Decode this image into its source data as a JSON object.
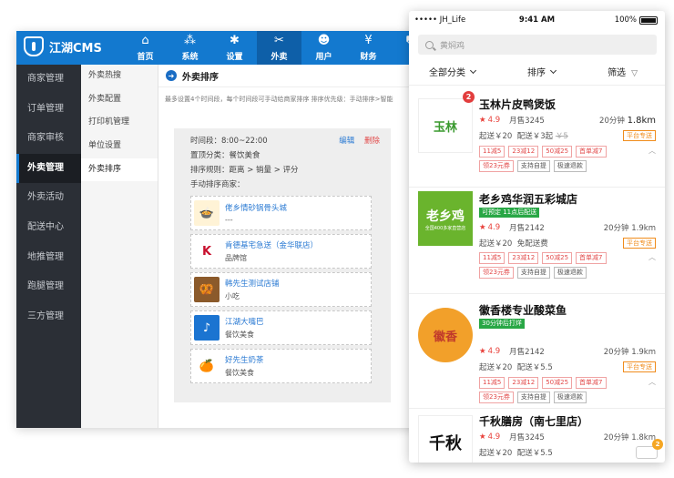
{
  "cms": {
    "logo_text": "江湖CMS",
    "nav": [
      {
        "icon": "⌂",
        "icon_name": "home-icon",
        "label": "首页"
      },
      {
        "icon": "⁂",
        "icon_name": "system-icon",
        "label": "系统"
      },
      {
        "icon": "✱",
        "icon_name": "gear-icon",
        "label": "设置"
      },
      {
        "icon": "✂",
        "icon_name": "takeout-icon",
        "label": "外卖"
      },
      {
        "icon": "☻",
        "icon_name": "user-icon",
        "label": "用户"
      },
      {
        "icon": "¥",
        "icon_name": "finance-icon",
        "label": "财务"
      },
      {
        "icon": "⛟",
        "icon_name": "operation-icon",
        "label": "运"
      }
    ],
    "sidebar": [
      {
        "label": "商家管理"
      },
      {
        "label": "订单管理"
      },
      {
        "label": "商家审核"
      },
      {
        "label": "外卖管理"
      },
      {
        "label": "外卖活动"
      },
      {
        "label": "配送中心"
      },
      {
        "label": "地推管理"
      },
      {
        "label": "跑腿管理"
      },
      {
        "label": "三方管理"
      }
    ],
    "subnav": [
      {
        "label": "外卖热搜"
      },
      {
        "label": "外卖配置"
      },
      {
        "label": "打印机管理"
      },
      {
        "label": "单位设置"
      },
      {
        "label": "外卖排序"
      }
    ],
    "content": {
      "title": "外卖排序",
      "hint": "最多设置4个时间段，每个时间段可手动给商家排序 排序优先级：手动排序>智能",
      "time_range": "时间段：8:00~22:00",
      "edit": "编辑",
      "delete": "删除",
      "top_category": "置顶分类：餐饮美食",
      "sort_rule": "排序规则：距离 > 销量 > 评分",
      "manual_label": "手动排序商家：",
      "shops": [
        {
          "name": "佬乡情砂锅骨头城",
          "category": "---",
          "thumb": "🍲"
        },
        {
          "name": "肯德基宅急送（金华联店）",
          "category": "品牌馆",
          "thumb": "K"
        },
        {
          "name": "韩先生测试店铺",
          "category": "小吃",
          "thumb": "🥨"
        },
        {
          "name": "江湖大嘴巴",
          "category": "餐饮美食",
          "thumb": "♪"
        },
        {
          "name": "好先生奶茶",
          "category": "餐饮美食",
          "thumb": "🍊"
        }
      ]
    }
  },
  "phone": {
    "status_left": "••••• JH_Life",
    "time": "9:41 AM",
    "battery": "100%",
    "search_placeholder": "黄焖鸡",
    "filters": [
      "全部分类",
      "排序",
      "筛选"
    ],
    "stores": [
      {
        "name": "玉林片皮鸭煲饭",
        "badge": "2",
        "logo": "玉林",
        "rating": "4.9",
        "sales": "月售3245",
        "time": "20分钟",
        "distance": "1.8km",
        "min_order": "起送￥20",
        "delivery": "配送￥3起",
        "old_delivery": "￥5",
        "platform": "平台专送",
        "promos": [
          "11减5",
          "23减12",
          "50减25",
          "首单减7"
        ],
        "extras": [
          "领23元券",
          "支持自提",
          "极速退款"
        ]
      },
      {
        "name": "老乡鸡华润五彩城店",
        "logo": "老乡鸡",
        "logo_sub": "全国400多家直营店",
        "tag": "可预定 11点后配送",
        "rating": "4.9",
        "sales": "月售2142",
        "time": "20分钟",
        "distance": "1.9km",
        "min_order": "起送￥20",
        "delivery": "免配送费",
        "platform": "平台专送",
        "promos": [
          "11减5",
          "23减12",
          "50减25",
          "首单减7"
        ],
        "extras": [
          "领23元券",
          "支持自提",
          "极速退款"
        ]
      },
      {
        "name": "徽香楼专业酸菜鱼",
        "logo": "徽香",
        "tag": "30分钟后打烊",
        "rating": "4.9",
        "sales": "月售2142",
        "time": "20分钟",
        "distance": "1.9km",
        "min_order": "起送￥20",
        "delivery": "配送￥5.5",
        "platform": "平台专送",
        "promos": [
          "11减5",
          "23减12",
          "50减25",
          "首单减7"
        ],
        "extras": [
          "领23元券",
          "支持自提",
          "极速退款"
        ]
      },
      {
        "name": "千秋膳房（南七里店）",
        "logo": "千秋",
        "rating": "4.9",
        "sales": "月售3245",
        "time": "20分钟",
        "distance": "1.8km",
        "min_order": "起送￥20",
        "delivery": "配送￥5.5"
      }
    ],
    "corner_badge": "2"
  },
  "colors": {
    "primary": "#1379cf",
    "sidebar": "#2b2f36",
    "red": "#e8413b",
    "orange": "#f08c1c",
    "green": "#28a745"
  }
}
